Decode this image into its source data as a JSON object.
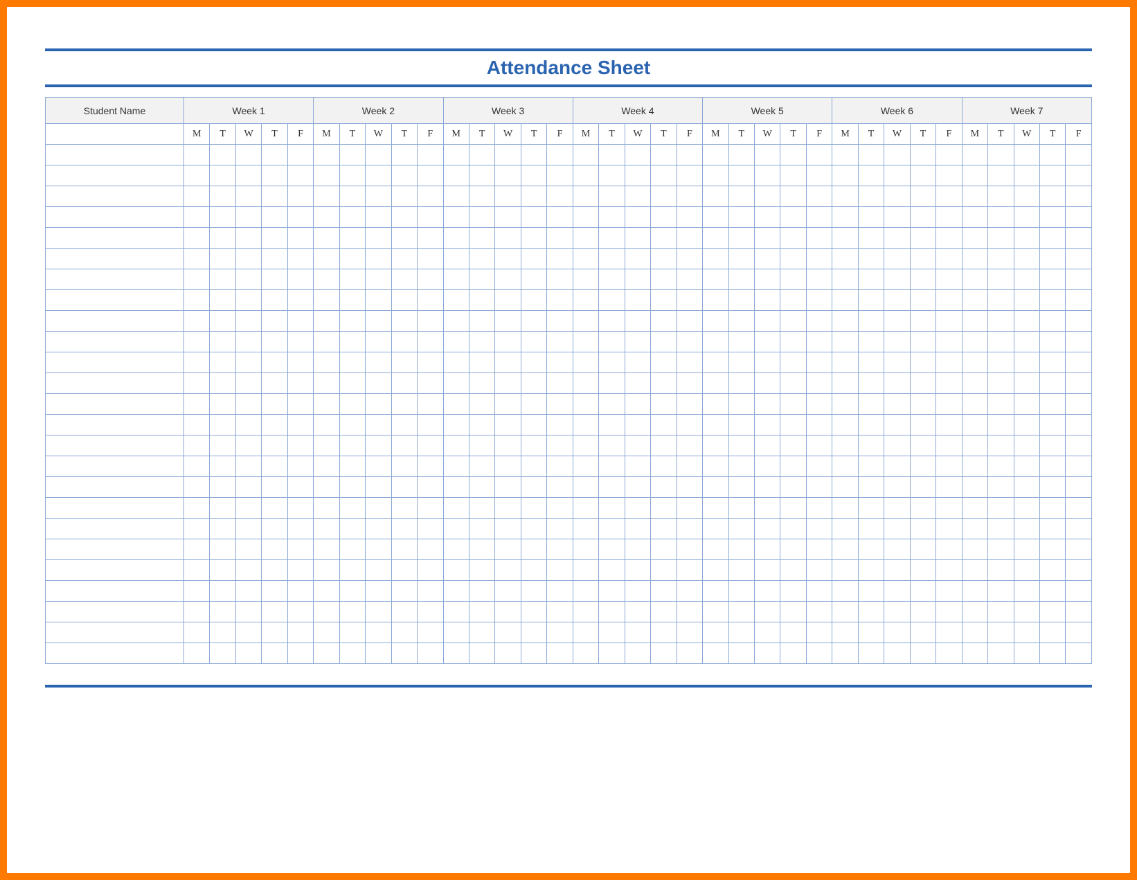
{
  "title": "Attendance Sheet",
  "headers": {
    "student_name": "Student Name",
    "weeks": [
      "Week 1",
      "Week 2",
      "Week 3",
      "Week 4",
      "Week 5",
      "Week 6",
      "Week 7"
    ],
    "days": [
      "M",
      "T",
      "W",
      "T",
      "F"
    ]
  },
  "rows": 25,
  "colors": {
    "accent": "#2a64b0",
    "border": "#8aa8d6",
    "header_bg": "#f2f2f2",
    "frame": "#ff7a00"
  }
}
